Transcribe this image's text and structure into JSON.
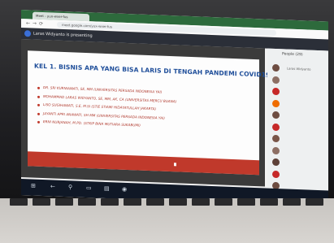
{
  "browser": {
    "tab_title": "Meet - yux-wxer-fus",
    "url": "meet.google.com/yux-wxer-fus"
  },
  "meet": {
    "presenting_text": "Laras Widyanto is presenting"
  },
  "slide": {
    "title": "KEL 1. BISNIS APA YANG BISA LARIS DI TENGAH PANDEMI COVID19.",
    "members": [
      "DR. SRI KURNIAWATI, SE, MM (UNIVERSITAS PERSADA INDONESIA YAI)",
      "MOHAMMAD LARAS WIDYANTO, SE, MM, AK, CA (UNIVERSITAS MERCU BUANA)",
      "LISO SUGIHAWATI, S.E, M.SI (STIE STIAMI HIDAYATULLAH JAKARTA)",
      "JAYANTI APRI ANAWATI, SH MM (UNIVERSITAS PERSADA INDONESIA YAI)",
      "ERNI NURJANAH, M.PD. (STKIP BINA MUTIARA SUKABUMI)"
    ],
    "band_color": "#c0392b",
    "title_color": "#1f4e9a"
  },
  "people": {
    "title": "People (29)",
    "items": [
      {
        "name": "Laras Widyanto",
        "color": "#6d4c41"
      },
      {
        "name": "",
        "color": "#8d6e63"
      },
      {
        "name": "",
        "color": "#c62828"
      },
      {
        "name": "",
        "color": "#ef6c00"
      },
      {
        "name": "",
        "color": "#6d4c41"
      },
      {
        "name": "",
        "color": "#c62828"
      },
      {
        "name": "",
        "color": "#795548"
      },
      {
        "name": "",
        "color": "#8d6e63"
      },
      {
        "name": "",
        "color": "#5d4037"
      },
      {
        "name": "",
        "color": "#c62828"
      },
      {
        "name": "",
        "color": "#6d4c41"
      }
    ]
  },
  "taskbar": {
    "icons": [
      "windows-icon",
      "back-icon",
      "search-icon",
      "task-view-icon",
      "folder-icon",
      "chrome-icon"
    ],
    "time": "",
    "date": ""
  }
}
